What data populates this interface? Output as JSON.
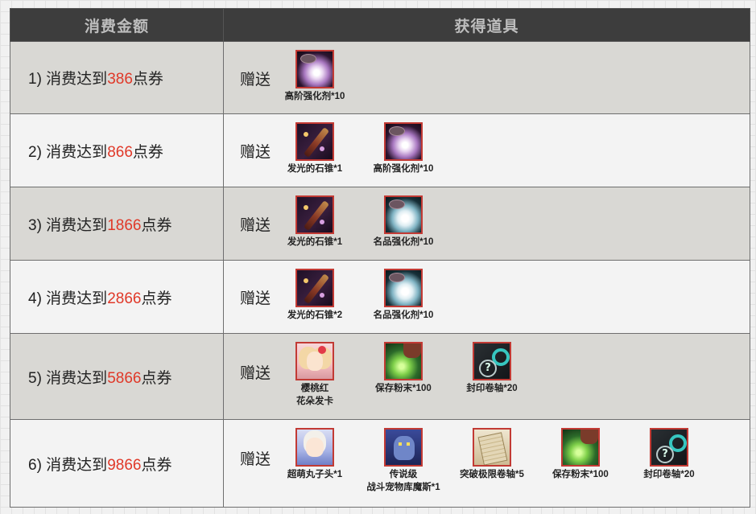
{
  "header": {
    "col1": "消费金额",
    "col2": "获得道具"
  },
  "gift_label": "赠送",
  "tiers": [
    {
      "prefix": "1) 消费达到",
      "amount": "386",
      "suffix": "点券",
      "items": [
        {
          "name": "高阶强化剂*10",
          "icon": "enhance-powder-high-icon"
        }
      ]
    },
    {
      "prefix": "2) 消费达到",
      "amount": "866",
      "suffix": "点券",
      "items": [
        {
          "name": "发光的石锥*1",
          "icon": "glowing-stone-awl-icon"
        },
        {
          "name": "高阶强化剂*10",
          "icon": "enhance-powder-high-icon"
        }
      ]
    },
    {
      "prefix": "3) 消费达到",
      "amount": "1866",
      "suffix": "点券",
      "items": [
        {
          "name": "发光的石锥*1",
          "icon": "glowing-stone-awl-icon"
        },
        {
          "name": "名品强化剂*10",
          "icon": "enhance-powder-premium-icon"
        }
      ]
    },
    {
      "prefix": "4) 消费达到",
      "amount": "2866",
      "suffix": "点券",
      "items": [
        {
          "name": "发光的石锥*2",
          "icon": "glowing-stone-awl-icon"
        },
        {
          "name": "名品强化剂*10",
          "icon": "enhance-powder-premium-icon"
        }
      ]
    },
    {
      "prefix": "5) 消费达到",
      "amount": "5866",
      "suffix": "点券",
      "items": [
        {
          "name": "樱桃红",
          "name2": "花朵发卡",
          "icon": "cherry-flower-hairpin-icon"
        },
        {
          "name": "保存粉末*100",
          "icon": "preservation-powder-icon"
        },
        {
          "name": "封印卷轴*20",
          "icon": "seal-scroll-icon"
        }
      ]
    },
    {
      "prefix": "6) 消费达到",
      "amount": "9866",
      "suffix": "点券",
      "items": [
        {
          "name": "超萌丸子头*1",
          "icon": "cute-bun-hairstyle-icon"
        },
        {
          "name": "传说级",
          "name2": "战斗宠物库魔斯*1",
          "icon": "battle-pet-kumos-icon"
        },
        {
          "name": "突破极限卷轴*5",
          "icon": "limit-break-scroll-icon"
        },
        {
          "name": "保存粉末*100",
          "icon": "preservation-powder-icon"
        },
        {
          "name": "封印卷轴*20",
          "icon": "seal-scroll-icon"
        }
      ]
    }
  ]
}
